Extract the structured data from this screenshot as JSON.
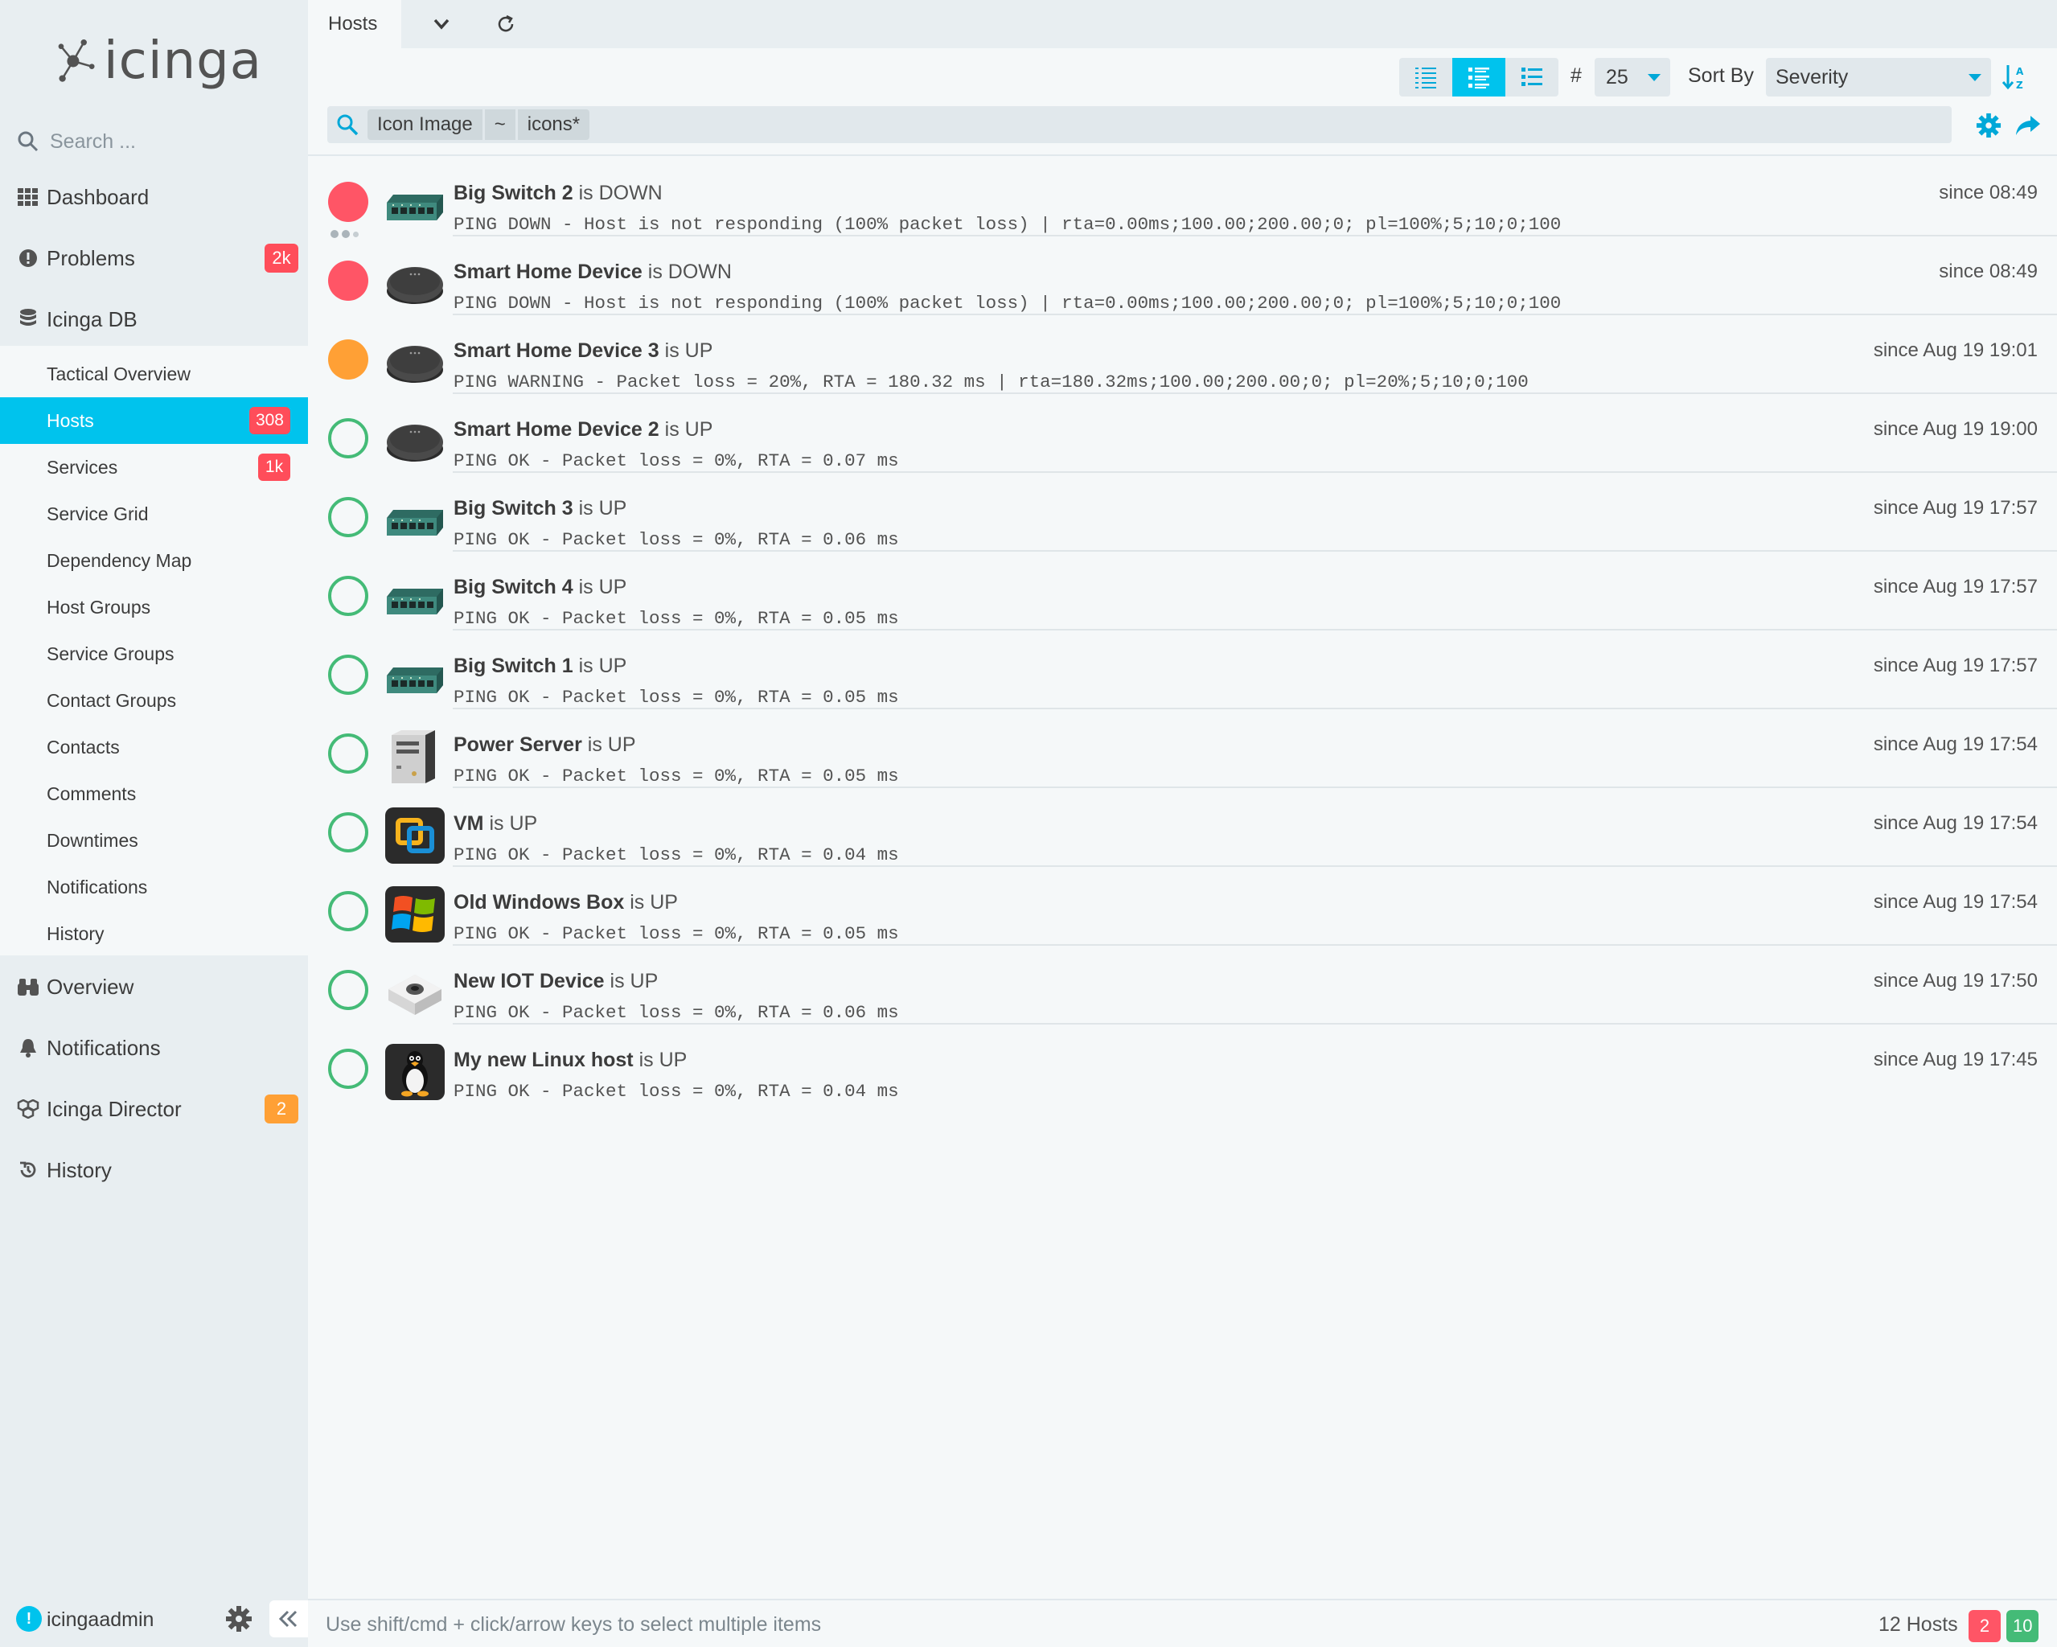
{
  "sidebar": {
    "logo_text": "icinga",
    "search_placeholder": "Search ...",
    "main_items": [
      {
        "label": "Dashboard",
        "icon": "dashboard-grid-icon"
      },
      {
        "label": "Problems",
        "icon": "alert-circle-icon",
        "badge": "2k",
        "badge_color": "#ff4d5a"
      },
      {
        "label": "Icinga DB",
        "icon": "database-icon"
      }
    ],
    "sub_items": [
      {
        "label": "Tactical Overview"
      },
      {
        "label": "Hosts",
        "badge": "308",
        "active": true
      },
      {
        "label": "Services",
        "badge": "1k"
      },
      {
        "label": "Service Grid"
      },
      {
        "label": "Dependency Map"
      },
      {
        "label": "Host Groups"
      },
      {
        "label": "Service Groups"
      },
      {
        "label": "Contact Groups"
      },
      {
        "label": "Contacts"
      },
      {
        "label": "Comments"
      },
      {
        "label": "Downtimes"
      },
      {
        "label": "Notifications"
      },
      {
        "label": "History"
      }
    ],
    "bottom_items": [
      {
        "label": "Overview",
        "icon": "binoculars-icon"
      },
      {
        "label": "Notifications",
        "icon": "bell-icon"
      },
      {
        "label": "Icinga Director",
        "icon": "cubes-icon",
        "badge": "2",
        "badge_color": "#ffa035"
      },
      {
        "label": "History",
        "icon": "history-icon"
      }
    ],
    "user": {
      "name": "icingaadmin",
      "initial": "!"
    }
  },
  "tabs": {
    "active": "Hosts"
  },
  "controls": {
    "limit_symbol": "#",
    "limit_value": "25",
    "sort_label": "Sort By",
    "sort_value": "Severity"
  },
  "filter": {
    "column": "Icon Image",
    "operator": "~",
    "value": "icons*"
  },
  "hosts": [
    {
      "name": "Big Switch 2",
      "state_text": " is DOWN",
      "state": "down",
      "icon": "network-switch-icon",
      "output": "PING DOWN - Host is not responding (100% packet loss) | rta=0.00ms;100.00;200.00;0; pl=100%;5;10;0;100",
      "since": "since 08:49",
      "loading": true
    },
    {
      "name": "Smart Home Device",
      "state_text": " is DOWN",
      "state": "down",
      "icon": "smart-speaker-icon",
      "output": "PING DOWN - Host is not responding (100% packet loss) | rta=0.00ms;100.00;200.00;0; pl=100%;5;10;0;100",
      "since": "since 08:49"
    },
    {
      "name": "Smart Home Device 3",
      "state_text": " is UP",
      "state": "warn",
      "icon": "smart-speaker-icon",
      "output": "PING WARNING - Packet loss = 20%, RTA = 180.32 ms | rta=180.32ms;100.00;200.00;0; pl=20%;5;10;0;100",
      "since": "since Aug 19 19:01"
    },
    {
      "name": "Smart Home Device 2",
      "state_text": " is UP",
      "state": "up",
      "icon": "smart-speaker-icon",
      "output": "PING OK - Packet loss = 0%, RTA = 0.07 ms",
      "since": "since Aug 19 19:00"
    },
    {
      "name": "Big Switch 3",
      "state_text": " is UP",
      "state": "up",
      "icon": "network-switch-icon",
      "output": "PING OK - Packet loss = 0%, RTA = 0.06 ms",
      "since": "since Aug 19 17:57"
    },
    {
      "name": "Big Switch 4",
      "state_text": " is UP",
      "state": "up",
      "icon": "network-switch-icon",
      "output": "PING OK - Packet loss = 0%, RTA = 0.05 ms",
      "since": "since Aug 19 17:57"
    },
    {
      "name": "Big Switch 1",
      "state_text": " is UP",
      "state": "up",
      "icon": "network-switch-icon",
      "output": "PING OK - Packet loss = 0%, RTA = 0.05 ms",
      "since": "since Aug 19 17:57"
    },
    {
      "name": "Power Server",
      "state_text": " is UP",
      "state": "up",
      "icon": "server-tower-icon",
      "output": "PING OK - Packet loss = 0%, RTA = 0.05 ms",
      "since": "since Aug 19 17:54"
    },
    {
      "name": "VM",
      "state_text": " is UP",
      "state": "up",
      "icon": "vmware-icon",
      "output": "PING OK - Packet loss = 0%, RTA = 0.04 ms",
      "since": "since Aug 19 17:54"
    },
    {
      "name": "Old Windows Box",
      "state_text": " is UP",
      "state": "up",
      "icon": "windows-logo-icon",
      "output": "PING OK - Packet loss = 0%, RTA = 0.05 ms",
      "since": "since Aug 19 17:54"
    },
    {
      "name": "New IOT Device",
      "state_text": " is UP",
      "state": "up",
      "icon": "iot-device-icon",
      "output": "PING OK - Packet loss = 0%, RTA = 0.06 ms",
      "since": "since Aug 19 17:50"
    },
    {
      "name": "My new Linux host",
      "state_text": " is UP",
      "state": "up",
      "icon": "linux-tux-icon",
      "output": "PING OK - Packet loss = 0%, RTA = 0.04 ms",
      "since": "since Aug 19 17:45"
    }
  ],
  "footer": {
    "hint": "Use shift/cmd + click/arrow keys to select multiple items",
    "count": "12 Hosts",
    "down_count": "2",
    "up_count": "10"
  },
  "colors": {
    "accent": "#00c3ed",
    "down": "#ff5566",
    "warning": "#ffa035",
    "up": "#44bb77"
  }
}
